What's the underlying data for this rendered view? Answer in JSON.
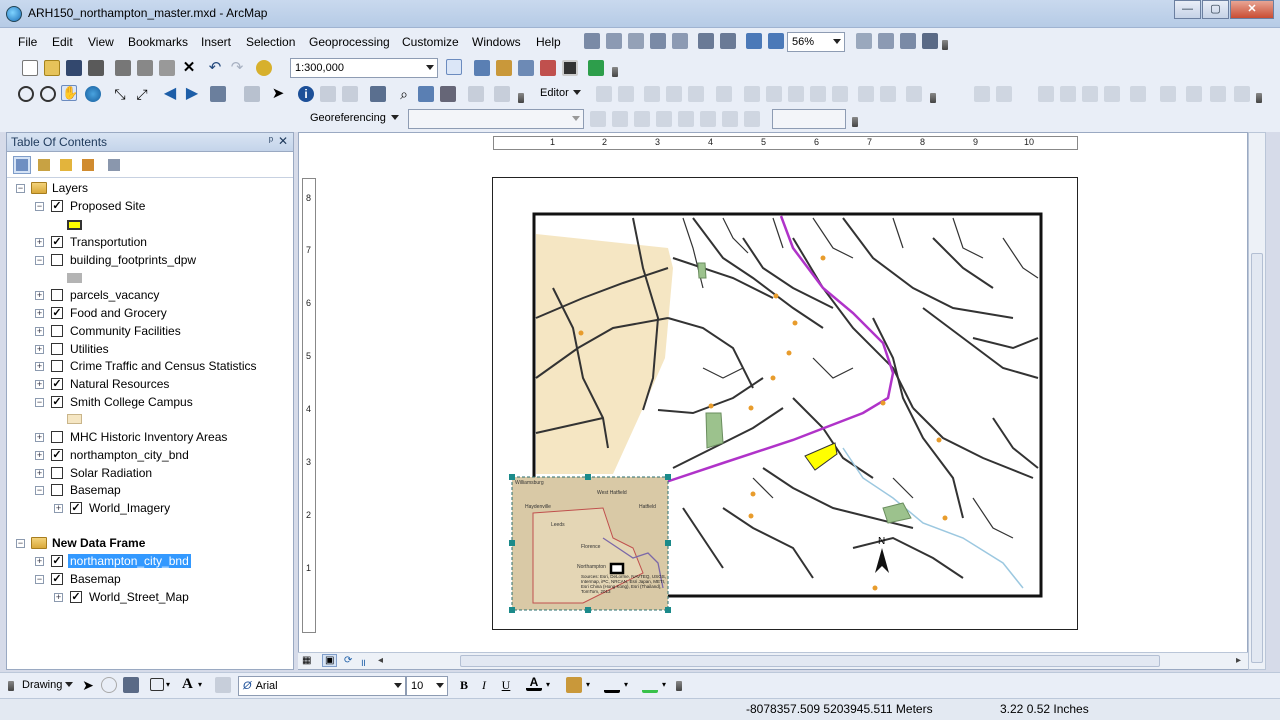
{
  "window": {
    "title": "ARH150_northampton_master.mxd - ArcMap",
    "minimize": "—",
    "maximize": "▢",
    "close": "✕"
  },
  "menu": [
    "File",
    "Edit",
    "View",
    "Bookmarks",
    "Insert",
    "Selection",
    "Geoprocessing",
    "Customize",
    "Windows",
    "Help"
  ],
  "toolbar": {
    "zoom_percent": "56%",
    "scale": "1:300,000",
    "editor_label": "Editor",
    "georef_label": "Georeferencing"
  },
  "toc": {
    "title": "Table Of Contents",
    "pin": "ᵖ",
    "close": "✕",
    "frame1": "Layers",
    "layers": [
      {
        "name": "Proposed Site",
        "checked": true
      },
      {
        "name": "Transportution",
        "checked": true
      },
      {
        "name": "building_footprints_dpw",
        "checked": false
      },
      {
        "name": "parcels_vacancy",
        "checked": false
      },
      {
        "name": "Food and Grocery",
        "checked": true
      },
      {
        "name": "Community Facilities",
        "checked": false
      },
      {
        "name": "Utilities",
        "checked": false
      },
      {
        "name": "Crime Traffic and Census Statistics",
        "checked": false
      },
      {
        "name": "Natural Resources",
        "checked": true
      },
      {
        "name": "Smith College Campus",
        "checked": true
      },
      {
        "name": "MHC Historic Inventory Areas",
        "checked": false
      },
      {
        "name": "northampton_city_bnd",
        "checked": true
      },
      {
        "name": "Solar Radiation",
        "checked": false
      },
      {
        "name": "Basemap",
        "checked": false
      },
      {
        "name": "World_Imagery",
        "checked": true
      }
    ],
    "frame2": "New Data Frame",
    "layers2": [
      {
        "name": "northampton_city_bnd",
        "checked": true
      },
      {
        "name": "Basemap",
        "checked": true
      },
      {
        "name": "World_Street_Map",
        "checked": true
      }
    ]
  },
  "ruler_h": [
    "1",
    "2",
    "3",
    "4",
    "5",
    "6",
    "7",
    "8",
    "9",
    "10"
  ],
  "ruler_v": [
    "8",
    "7",
    "6",
    "5",
    "4",
    "3",
    "2",
    "1"
  ],
  "map": {
    "north_label": "N",
    "inset_labels": [
      "Williamsburg",
      "West Hatfield",
      "Haydenville",
      "Hatfield",
      "Leeds",
      "Florence",
      "Northampton"
    ],
    "inset_credits": "Sources: Esri, DeLorme, NAVTEQ, USGS, Intermap, iPC, NRCAN, Esri Japan, METI, Esri China (Hong Kong), Esri (Thailand), TomTom, 2013"
  },
  "drawing": {
    "label": "Drawing",
    "font": "Arial",
    "size": "10",
    "bold": "B",
    "italic": "I",
    "underline": "U",
    "font_color": "A"
  },
  "status": {
    "coords": "-8078357.509  5203945.511 Meters",
    "page_pos": "3.22  0.52 Inches"
  },
  "colors": {
    "proposed_site": "#ffff00",
    "smith_campus": "#f5e6c3",
    "building": "#b4b4b4",
    "route": "#b033c9"
  }
}
